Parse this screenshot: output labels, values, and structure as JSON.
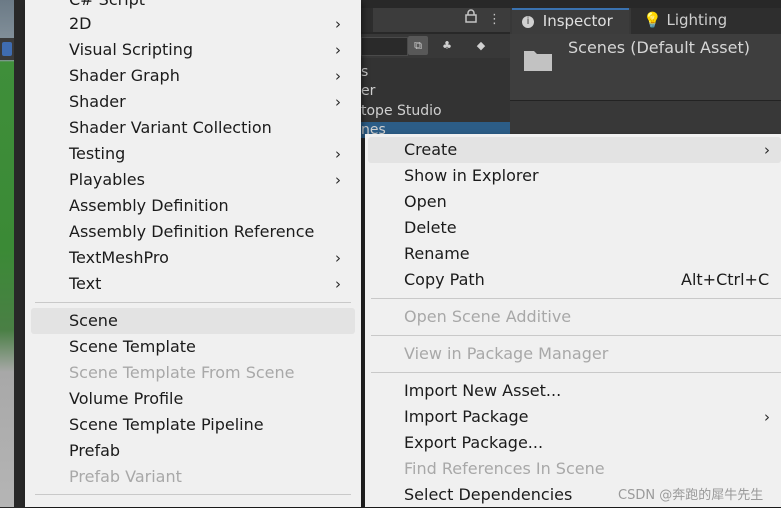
{
  "project_panel": {
    "items": [
      "s",
      "er",
      "tope Studio",
      "nes"
    ],
    "lock_icon": "lock-icon",
    "more_icon": "kebab-icon"
  },
  "inspector": {
    "tab_label": "Inspector",
    "lighting_tab_label": "Lighting",
    "title": "Scenes (Default Asset)"
  },
  "create_menu": {
    "cut_top_label": "C# Script",
    "items": [
      {
        "label": "2D",
        "submenu": true
      },
      {
        "label": "Visual Scripting",
        "submenu": true
      },
      {
        "label": "Shader Graph",
        "submenu": true
      },
      {
        "label": "Shader",
        "submenu": true
      },
      {
        "label": "Shader Variant Collection",
        "submenu": false
      },
      {
        "label": "Testing",
        "submenu": true
      },
      {
        "label": "Playables",
        "submenu": true
      },
      {
        "label": "Assembly Definition",
        "submenu": false
      },
      {
        "label": "Assembly Definition Reference",
        "submenu": false
      },
      {
        "label": "TextMeshPro",
        "submenu": true
      },
      {
        "label": "Text",
        "submenu": true
      }
    ],
    "scene_items": [
      {
        "label": "Scene",
        "disabled": false,
        "highlighted": true
      },
      {
        "label": "Scene Template",
        "disabled": false
      },
      {
        "label": "Scene Template From Scene",
        "disabled": true
      },
      {
        "label": "Volume Profile",
        "disabled": false
      },
      {
        "label": "Scene Template Pipeline",
        "disabled": false
      },
      {
        "label": "Prefab",
        "disabled": false
      },
      {
        "label": "Prefab Variant",
        "disabled": true
      }
    ]
  },
  "context_menu": {
    "items": [
      {
        "label": "Create",
        "submenu": true,
        "highlighted": true
      },
      {
        "label": "Show in Explorer"
      },
      {
        "label": "Open"
      },
      {
        "label": "Delete"
      },
      {
        "label": "Rename"
      },
      {
        "label": "Copy Path",
        "shortcut": "Alt+Ctrl+C"
      }
    ],
    "open_scene_additive": "Open Scene Additive",
    "view_in_package_manager": "View in Package Manager",
    "import_items": [
      {
        "label": "Import New Asset...",
        "disabled": false
      },
      {
        "label": "Import Package",
        "submenu": true,
        "disabled": false
      },
      {
        "label": "Export Package...",
        "disabled": false
      },
      {
        "label": "Find References In Scene",
        "disabled": true
      },
      {
        "label": "Select Dependencies",
        "disabled": false
      }
    ]
  },
  "watermark": "CSDN @奔跑的犀牛先生",
  "colors": {
    "menu_bg": "#f0f0f0",
    "highlight": "#e3e3e3",
    "disabled_text": "#a8a8a8",
    "selection_blue": "#2c5d87"
  }
}
